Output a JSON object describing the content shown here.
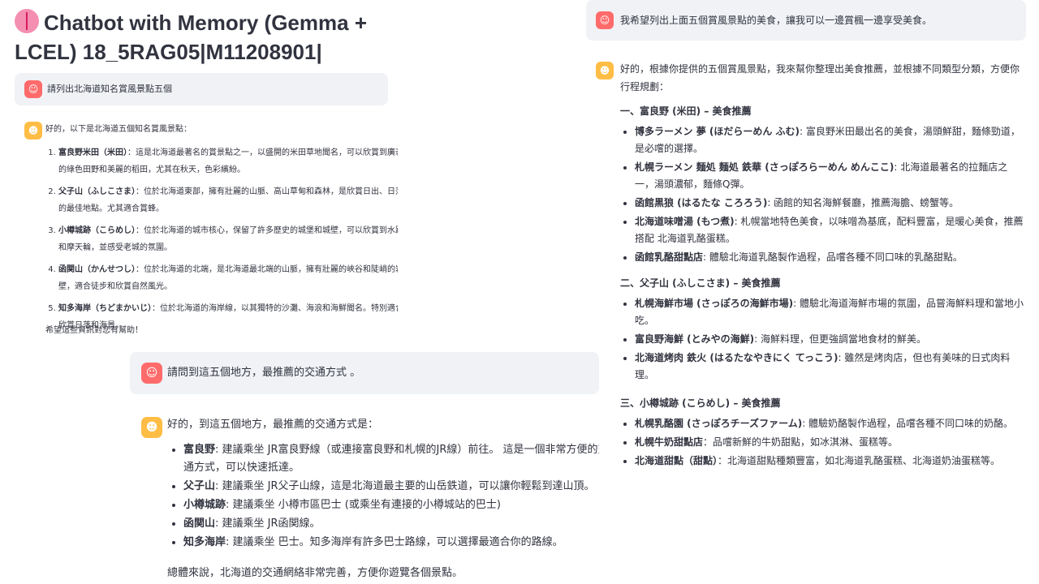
{
  "title": "Chatbot with Memory (Gemma + LCEL) 18_5RAG05|M11208901|",
  "icons": {
    "title": "brain-icon",
    "user": "user-avatar-icon",
    "bot": "bot-avatar-icon"
  },
  "colors": {
    "user_avatar": "#ff6b6b",
    "bot_avatar": "#ffbd45",
    "user_bubble": "#f0f2f6"
  },
  "q1": "請列出北海道知名賞風景點五個",
  "a1": {
    "intro": "好的，以下是北海道五個知名賞風景點：",
    "items": [
      {
        "name": "富良野米田（米田）",
        "desc": "：這是北海道最著名的賞景點之一，以盛開的米田草地聞名，可以欣賞到廣袤的綠色田野和美麗的稻田，尤其在秋天，色彩繽紛。"
      },
      {
        "name": "父子山（ふしこさま）",
        "desc": "：位於北海道東部，擁有壯麗的山脈、高山草甸和森林，是欣賞日出、日落的最佳地點。尤其適合賞蜂。"
      },
      {
        "name": "小樽城跡（こらめし）",
        "desc": "：位於北海道的城市核心，保留了許多歷史的城堡和城壁，可以欣賞到水路和摩天輪，並感受老城的氛圍。"
      },
      {
        "name": "函関山（かんせつし）",
        "desc": "：位於北海道的北端，是北海道最北端的山脈，擁有壯麗的峽谷和陡峭的岩壁，適合徒步和欣賞自然風光。"
      },
      {
        "name": "知多海岸（ちどまかいじ）",
        "desc": "：位於北海道的海岸線，以其獨特的沙灘、海浪和海鮮聞名。特別適合欣賞日落和海景。"
      }
    ],
    "outro": "希望這些資訊對您有幫助！"
  },
  "q2": "請問到這五個地方，最推薦的交通方式 。",
  "a2": {
    "intro": "好的，到這五個地方，最推薦的交通方式是：",
    "items": [
      {
        "name": "富良野",
        "desc": ": 建議乘坐 JR富良野線（或連接富良野和札幌的JR線）前往。 這是一個非常方便的交通方式，可以快速抵達。"
      },
      {
        "name": "父子山",
        "desc": ": 建議乘坐 JR父子山線，這是北海道最主要的山岳鉄道，可以讓你輕鬆到達山頂。"
      },
      {
        "name": "小樽城跡",
        "desc": ": 建議乘坐 小樽市區巴士 (或乘坐有連接的小樽城站的巴士)"
      },
      {
        "name": "函関山",
        "desc": ": 建議乘坐 JR函関線。"
      },
      {
        "name": "知多海岸",
        "desc": ": 建議乘坐 巴士。知多海岸有許多巴士路線，可以選擇最適合你的路線。"
      }
    ],
    "outro": "總體來說，北海道的交通網絡非常完善，方便你遊覽各個景點。"
  },
  "q3": "我希望列出上面五個賞風景點的美食，讓我可以一邊賞楓一邊享受美食。",
  "a3": {
    "intro": "好的，根據你提供的五個賞風景點，我來幫你整理出美食推薦，並根據不同類型分類，方便你行程規劃：",
    "sections": [
      {
        "title": "一、富良野 (米田) – 美食推薦",
        "items": [
          {
            "name": "博多ラーメン 夢 (ほだらーめん ふむ)",
            "desc": ": 富良野米田最出名的美食，湯頭鮮甜，麵條勁道，是必嚐的選擇。"
          },
          {
            "name": "札幌ラーメン 麺処 麺処 鉄華 (さっぽろらーめん めんここ)",
            "desc": ": 北海道最著名的拉麵店之一，湯頭濃郁，麵條Q彈。"
          },
          {
            "name": "函館黒狼 (はるたな ころろう)",
            "desc": ": 函館的知名海鮮餐廳，推薦海膽、螃蟹等。"
          },
          {
            "name": "北海道味噌湯 (もつ煮)",
            "desc": ": 札幌當地特色美食，以味噌為基底，配料豐富，是暖心美食，推薦搭配 北海道乳酪蛋糕。"
          },
          {
            "name": "函館乳酪甜點店",
            "desc": ": 體驗北海道乳酪製作過程，品嚐各種不同口味的乳酪甜點。"
          }
        ]
      },
      {
        "title": "二、父子山 (ふしこさま) – 美食推薦",
        "items": [
          {
            "name": "札幌海鮮市場 (さっぽろの海鮮市場)",
            "desc": ": 體驗北海道海鮮市場的氛圍，品嘗海鮮料理和當地小吃。"
          },
          {
            "name": "富良野海鮮 (とみやの海鮮)",
            "desc": ": 海鮮料理，但更強調當地食材的鮮美。"
          },
          {
            "name": "北海道烤肉 鉄火 (はるたなやきにく てっこう)",
            "desc": ": 雖然是烤肉店，但也有美味的日式肉料理。"
          }
        ]
      },
      {
        "title": "三、小樽城跡 (こらめし) – 美食推薦",
        "items": [
          {
            "name": "札幌乳酪園 (さっぽろチーズファーム)",
            "desc": ": 體驗奶酪製作過程，品嚐各種不同口味的奶酪。"
          },
          {
            "name": "札幌牛奶甜點店",
            "desc": "：品嚐新鮮的牛奶甜點，如冰淇淋、蛋糕等。"
          },
          {
            "name": "北海道甜點（甜點）",
            "desc": "：北海道甜點種類豐富，如北海道乳酪蛋糕、北海道奶油蛋糕等。"
          }
        ]
      }
    ]
  }
}
